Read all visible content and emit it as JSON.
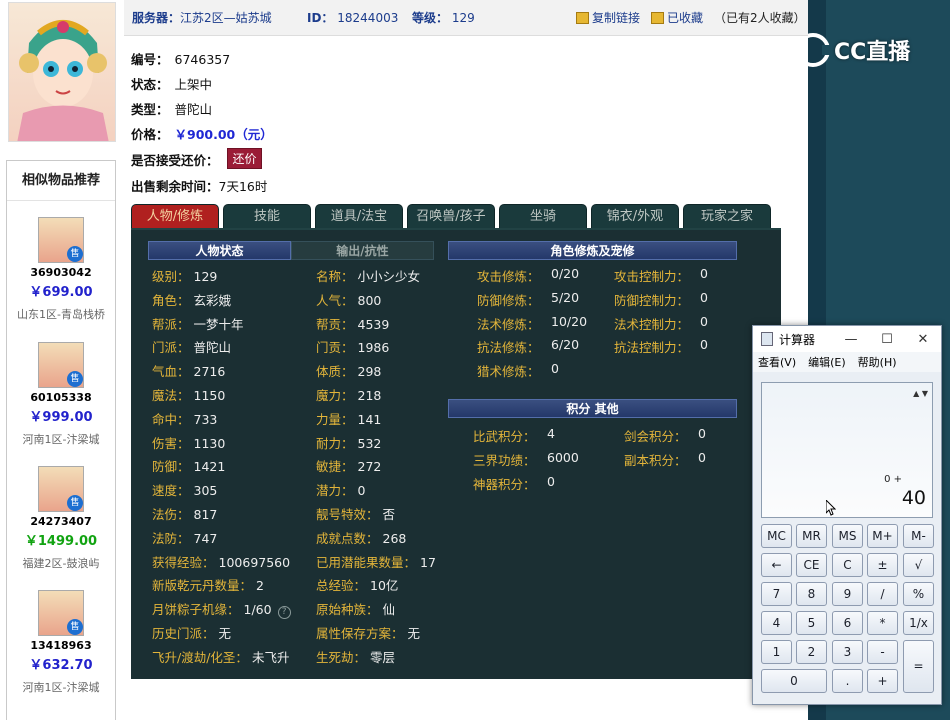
{
  "topbar": {
    "server_label": "服务器：",
    "server_value": "江苏2区—姑苏城",
    "id_label": "ID：",
    "id_value": "18244003",
    "level_label": "等级：",
    "level_value": "129",
    "copy_link": "复制链接",
    "favorited": "已收藏",
    "fav_count": "（已有2人收藏）"
  },
  "item": {
    "number_label": "编号：",
    "number_value": "6746357",
    "status_label": "状态：",
    "status_value": "上架中",
    "type_label": "类型：",
    "type_value": "普陀山",
    "price_label": "价格：",
    "price_value": "￥900.00（元）",
    "counter_label": "是否接受还价：",
    "counter_button": "还价",
    "remaining_label": "出售剩余时间：",
    "remaining_value": "7天16时"
  },
  "similar": {
    "title": "相似物品推荐",
    "sale_badge": "售",
    "items": [
      {
        "id": "36903042",
        "price": "￥699.00",
        "server": "山东1区-青岛栈桥",
        "price_color": "#2222cc"
      },
      {
        "id": "60105338",
        "price": "￥999.00",
        "server": "河南1区-汴梁城",
        "price_color": "#2222cc"
      },
      {
        "id": "24273407",
        "price": "￥1499.00",
        "server": "福建2区-鼓浪屿",
        "price_color": "#11a311"
      },
      {
        "id": "13418963",
        "price": "￥632.70",
        "server": "河南1区-汴梁城",
        "price_color": "#2222cc"
      }
    ]
  },
  "tabs": [
    "人物/修炼",
    "技能",
    "道具/法宝",
    "召唤兽/孩子",
    "坐骑",
    "锦衣/外观",
    "玩家之家"
  ],
  "panel": {
    "status_head": "人物状态",
    "resist_head": "输出/抗性",
    "cultivation_head": "角色修炼及宠修",
    "points_head": "积分 其他",
    "left_col": [
      {
        "k": "级别：",
        "v": "129"
      },
      {
        "k": "角色：",
        "v": "玄彩娥"
      },
      {
        "k": "帮派：",
        "v": "一梦十年"
      },
      {
        "k": "门派：",
        "v": "普陀山"
      },
      {
        "k": "气血：",
        "v": "2716"
      },
      {
        "k": "魔法：",
        "v": "1150"
      },
      {
        "k": "命中：",
        "v": "733"
      },
      {
        "k": "伤害：",
        "v": "1130"
      },
      {
        "k": "防御：",
        "v": "1421"
      },
      {
        "k": "速度：",
        "v": "305"
      },
      {
        "k": "法伤：",
        "v": "817"
      },
      {
        "k": "法防：",
        "v": "747"
      },
      {
        "k": "获得经验：",
        "v": "100697560"
      },
      {
        "k": "新版乾元丹数量：",
        "v": "2"
      },
      {
        "k": "月饼粽子机缘：",
        "v": "1/60"
      },
      {
        "k": "历史门派：",
        "v": "无"
      },
      {
        "k": "飞升/渡劫/化圣：",
        "v": "未飞升"
      }
    ],
    "mid_col": [
      {
        "k": "名称：",
        "v": "小小シ少女"
      },
      {
        "k": "人气：",
        "v": "800"
      },
      {
        "k": "帮贡：",
        "v": "4539"
      },
      {
        "k": "门贡：",
        "v": "1986"
      },
      {
        "k": "体质：",
        "v": "298"
      },
      {
        "k": "魔力：",
        "v": "218"
      },
      {
        "k": "力量：",
        "v": "141"
      },
      {
        "k": "耐力：",
        "v": "532"
      },
      {
        "k": "敏捷：",
        "v": "272"
      },
      {
        "k": "潜力：",
        "v": "0"
      },
      {
        "k": "靓号特效：",
        "v": "否"
      },
      {
        "k": "成就点数：",
        "v": "268"
      },
      {
        "k": "已用潜能果数量：",
        "v": "17"
      },
      {
        "k": "总经验：",
        "v": "10亿"
      },
      {
        "k": "原始种族：",
        "v": "仙"
      },
      {
        "k": "属性保存方案：",
        "v": "无"
      },
      {
        "k": "生死劫：",
        "v": "零层"
      }
    ],
    "cult_left": [
      {
        "k": "攻击修炼：",
        "v": "0/20"
      },
      {
        "k": "防御修炼：",
        "v": "5/20"
      },
      {
        "k": "法术修炼：",
        "v": "10/20"
      },
      {
        "k": "抗法修炼：",
        "v": "6/20"
      },
      {
        "k": "猎术修炼：",
        "v": "0"
      }
    ],
    "cult_right": [
      {
        "k": "攻击控制力：",
        "v": "0"
      },
      {
        "k": "防御控制力：",
        "v": "0"
      },
      {
        "k": "法术控制力：",
        "v": "0"
      },
      {
        "k": "抗法控制力：",
        "v": "0"
      }
    ],
    "points_left": [
      {
        "k": "比武积分：",
        "v": "4"
      },
      {
        "k": "三界功绩：",
        "v": "6000"
      },
      {
        "k": "神器积分：",
        "v": "0"
      }
    ],
    "points_right": [
      {
        "k": "剑会积分：",
        "v": "0"
      },
      {
        "k": "副本积分：",
        "v": "0"
      }
    ],
    "help_glyph": "?"
  },
  "calculator": {
    "title": "计算器",
    "menu": [
      "查看(V)",
      "编辑(E)",
      "帮助(H)"
    ],
    "memory_line": "0 +",
    "display": "40",
    "keys": [
      [
        "MC",
        "MR",
        "MS",
        "M+",
        "M-"
      ],
      [
        "←",
        "CE",
        "C",
        "±",
        "√"
      ],
      [
        "7",
        "8",
        "9",
        "/",
        "%"
      ],
      [
        "4",
        "5",
        "6",
        "*",
        "1/x"
      ],
      [
        "1",
        "2",
        "3",
        "-",
        "="
      ],
      [
        "0",
        ".",
        "+"
      ]
    ]
  },
  "overlay": {
    "logo": "CC直播"
  },
  "colors": {
    "panel_bg": "#1b2f33",
    "key_color": "#e3b53a",
    "active_tab": "#b0201f",
    "price_blue": "#1f27d4"
  }
}
